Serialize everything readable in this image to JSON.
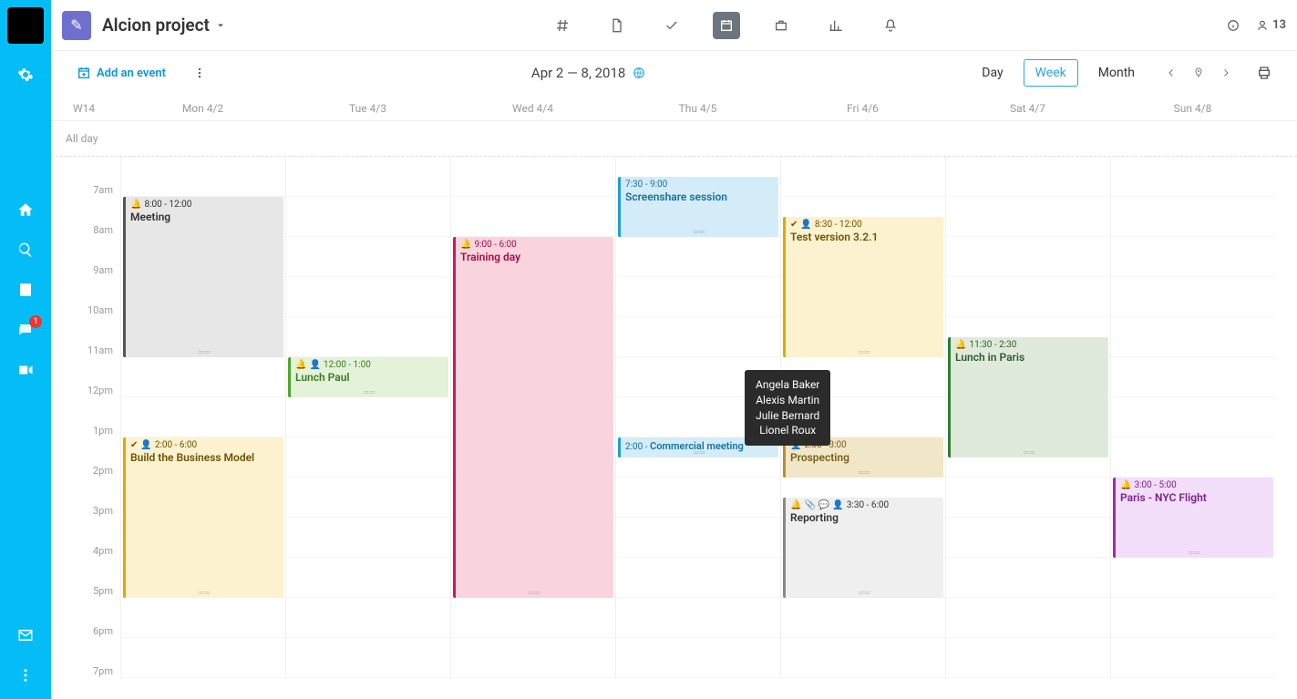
{
  "sidebar": {
    "chat_badge": "1"
  },
  "header": {
    "project_name": "Alcion project",
    "user_count": "13"
  },
  "subbar": {
    "add_event": "Add an event",
    "date_range": "Apr 2 — 8, 2018",
    "views": {
      "day": "Day",
      "week": "Week",
      "month": "Month"
    }
  },
  "calendar": {
    "week_label": "W14",
    "days": [
      "Mon 4/2",
      "Tue 4/3",
      "Wed 4/4",
      "Thu 4/5",
      "Fri 4/6",
      "Sat 4/7",
      "Sun 4/8"
    ],
    "allday_label": "All day",
    "hours": [
      "7am",
      "8am",
      "9am",
      "10am",
      "11am",
      "12pm",
      "1pm",
      "2pm",
      "3pm",
      "4pm",
      "5pm",
      "6pm",
      "7pm"
    ]
  },
  "events": {
    "meeting": {
      "time": "8:00 - 12:00",
      "title": "Meeting"
    },
    "build_model": {
      "time": "2:00 - 6:00",
      "title": "Build the Business Model"
    },
    "lunch_paul": {
      "time": "12:00 - 1:00",
      "title": "Lunch Paul"
    },
    "training": {
      "time": "9:00 - 6:00",
      "title": "Training day"
    },
    "screenshare": {
      "time": "7:30 - 9:00",
      "title": "Screenshare session"
    },
    "commercial": {
      "time": "2:00  - ",
      "title": "Commercial meeting"
    },
    "test_version": {
      "time": "8:30 - 12:00",
      "title": "Test version 3.2.1"
    },
    "prospecting": {
      "time": "2:00 - 3:00",
      "title": "Prospecting"
    },
    "reporting": {
      "time": "3:30 - 6:00",
      "title": "Reporting"
    },
    "lunch_paris": {
      "time": "11:30 - 2:30",
      "title": "Lunch in Paris"
    },
    "paris_nyc": {
      "time": "3:00 - 5:00",
      "title": "Paris - NYC Flight"
    }
  },
  "tooltip": {
    "l1": "Angela Baker",
    "l2": "Alexis Martin",
    "l3": "Julie Bernard",
    "l4": "Lionel Roux"
  },
  "colors": {
    "gray": {
      "bg": "#e7e7e7",
      "border": "#555",
      "text": "#333"
    },
    "yellow": {
      "bg": "#fdf2cf",
      "border": "#e0a800",
      "text": "#6b5400"
    },
    "green": {
      "bg": "#e3f2d8",
      "border": "#4fa52e",
      "text": "#3d7a22"
    },
    "pink": {
      "bg": "#f9d4df",
      "border": "#d1175a",
      "text": "#a00f46"
    },
    "blue": {
      "bg": "#d3ecf8",
      "border": "#1e9dd8",
      "text": "#17729a"
    },
    "darkyellow": {
      "bg": "#f1e6c8",
      "border": "#b5902a",
      "text": "#7a5f17"
    },
    "palegray": {
      "bg": "#efefef",
      "border": "#888",
      "text": "#333"
    },
    "sage": {
      "bg": "#e0eadb",
      "border": "#2e7d32",
      "text": "#2e5b30"
    },
    "lavender": {
      "bg": "#f3defa",
      "border": "#9b2bb5",
      "text": "#7a1f8e"
    }
  }
}
